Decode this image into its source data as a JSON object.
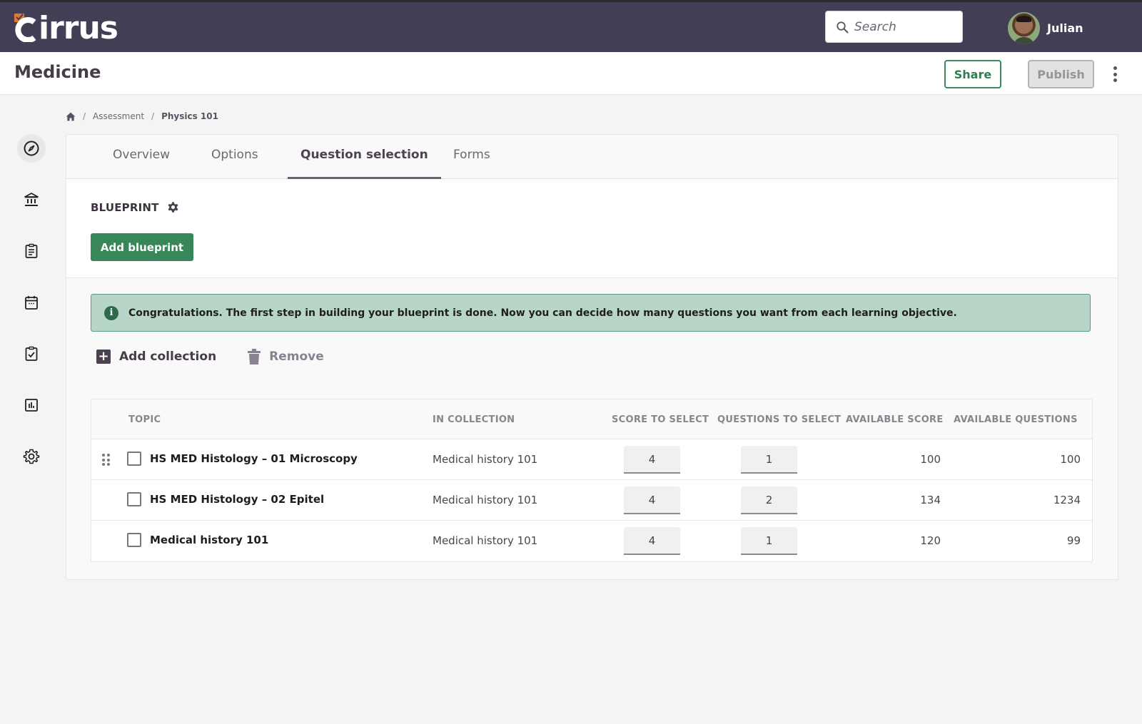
{
  "app": {
    "brand": "cirrus",
    "brand_accent": "#e07a2e",
    "search": {
      "placeholder": "Search",
      "value": ""
    },
    "user": {
      "name": "Julian"
    }
  },
  "titlebar": {
    "title": "Medicine",
    "share_label": "Share",
    "publish_label": "Publish"
  },
  "sidebar": {
    "items": [
      {
        "icon": "compass-icon",
        "active": true
      },
      {
        "icon": "bank-icon",
        "active": false
      },
      {
        "icon": "clipboard-list-icon",
        "active": false
      },
      {
        "icon": "calendar-icon",
        "active": false
      },
      {
        "icon": "clipboard-check-icon",
        "active": false
      },
      {
        "icon": "bar-chart-icon",
        "active": false
      },
      {
        "icon": "gear-icon",
        "active": false
      }
    ]
  },
  "breadcrumb": {
    "home_icon": "home-icon",
    "items": [
      "Assessment",
      "Physics 101"
    ],
    "separator": "/"
  },
  "tabs": [
    {
      "label": "Overview",
      "active": false
    },
    {
      "label": "Options",
      "active": false
    },
    {
      "label": "Question selection",
      "active": true
    },
    {
      "label": "Forms",
      "active": false
    }
  ],
  "blueprint": {
    "label": "BLUEPRINT",
    "add_label": "Add blueprint"
  },
  "alert": {
    "message": "Congratulations. The first step in building your blueprint is done. Now you can decide how many questions you want from each learning objective."
  },
  "actions": {
    "add_collection": "Add collection",
    "remove": "Remove"
  },
  "table": {
    "columns": [
      "TOPIC",
      "IN COLLECTION",
      "SCORE TO SELECT",
      "QUESTIONS TO SELECT",
      "AVAILABLE SCORE",
      "AVAILABLE QUESTIONS"
    ],
    "rows": [
      {
        "topic": "HS MED Histology – 01 Microscopy",
        "collection": "Medical history 101",
        "score_to_select": "4",
        "questions_to_select": "1",
        "available_score": "100",
        "available_questions": "100"
      },
      {
        "topic": "HS MED Histology – 02 Epitel",
        "collection": "Medical history 101",
        "score_to_select": "4",
        "questions_to_select": "2",
        "available_score": "134",
        "available_questions": "1234"
      },
      {
        "topic": "Medical history 101",
        "collection": "Medical history 101",
        "score_to_select": "4",
        "questions_to_select": "1",
        "available_score": "120",
        "available_questions": "99"
      }
    ]
  }
}
